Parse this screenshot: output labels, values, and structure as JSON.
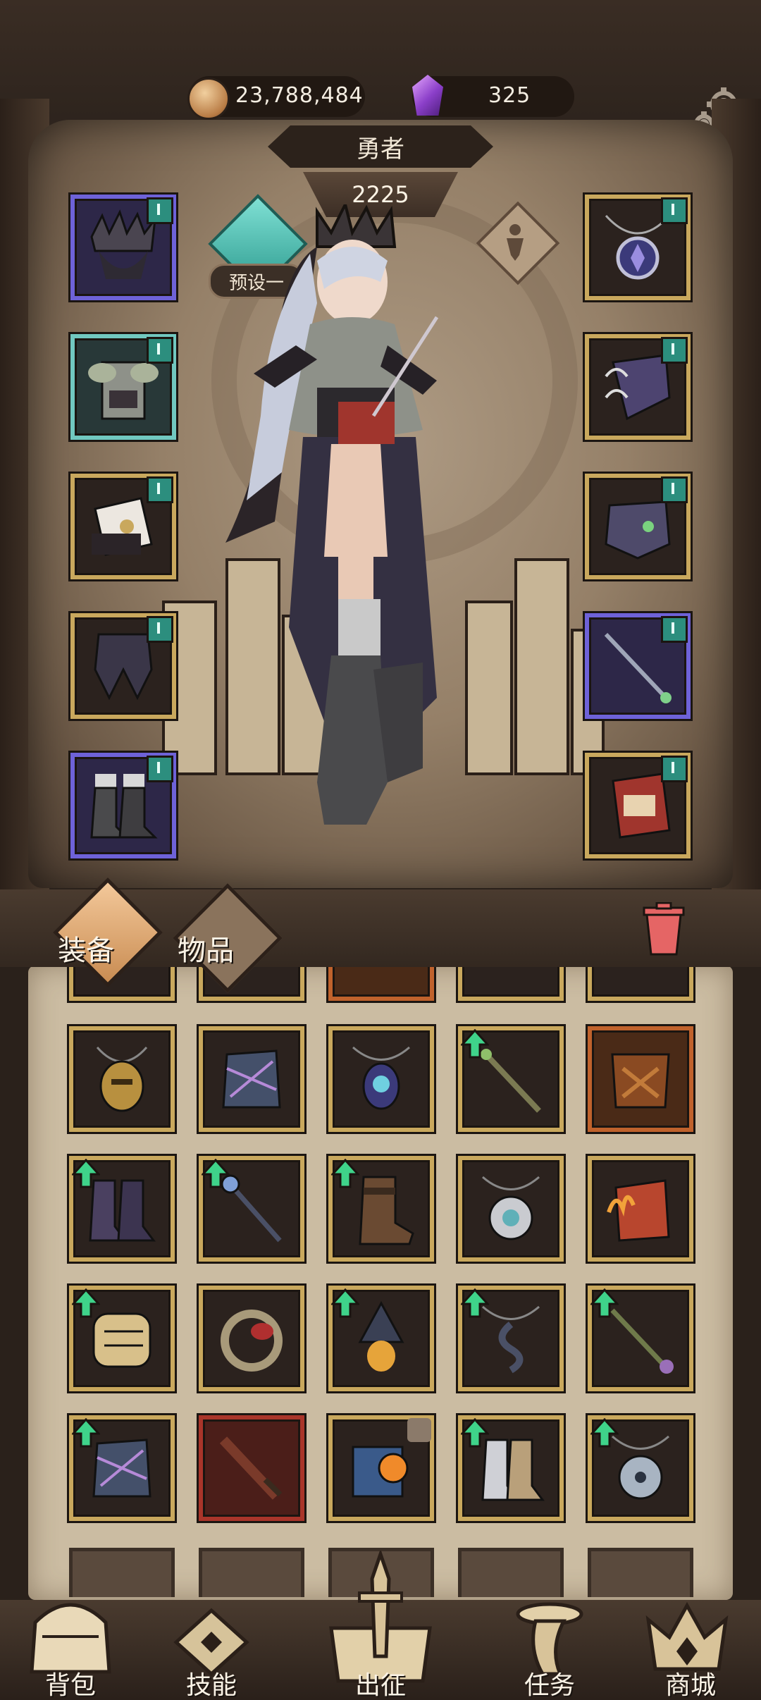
{
  "resources": {
    "gold": "23,788,484",
    "gems": "325"
  },
  "hero": {
    "name": "勇者",
    "power": "2225",
    "preset_label": "预设一"
  },
  "equipment_slots": {
    "left": [
      {
        "icon": "spiked-crown-icon",
        "rarity": "rare"
      },
      {
        "icon": "fur-cape-armor-icon",
        "rarity": "teal"
      },
      {
        "icon": "bracer-icon",
        "rarity": "gold"
      },
      {
        "icon": "leggings-icon",
        "rarity": "gold"
      },
      {
        "icon": "boots-icon",
        "rarity": "rare"
      }
    ],
    "right": [
      {
        "icon": "amulet-icon",
        "rarity": "gold"
      },
      {
        "icon": "claw-gauntlet-icon",
        "rarity": "gold"
      },
      {
        "icon": "beast-ring-icon",
        "rarity": "gold"
      },
      {
        "icon": "wand-icon",
        "rarity": "rare"
      },
      {
        "icon": "spellbook-icon",
        "rarity": "gold"
      }
    ]
  },
  "tabs": {
    "equipment": "装备",
    "items": "物品"
  },
  "inventory": {
    "rows": [
      [
        {
          "icon": "golden-mask-amulet-icon",
          "rarity": "gold",
          "upgrade": false
        },
        {
          "icon": "thorn-robe-icon",
          "rarity": "gold",
          "upgrade": false
        },
        {
          "icon": "eye-pendant-icon",
          "rarity": "gold",
          "upgrade": false
        },
        {
          "icon": "branch-staff-icon",
          "rarity": "gold",
          "upgrade": true
        },
        {
          "icon": "rusted-armor-icon",
          "rarity": "orange",
          "upgrade": false
        }
      ],
      [
        {
          "icon": "purple-boots-icon",
          "rarity": "gold",
          "upgrade": true
        },
        {
          "icon": "bone-scepter-icon",
          "rarity": "gold",
          "upgrade": true
        },
        {
          "icon": "leather-boot-icon",
          "rarity": "gold",
          "upgrade": true
        },
        {
          "icon": "disc-amulet-icon",
          "rarity": "gold",
          "upgrade": false
        },
        {
          "icon": "flame-tome-icon",
          "rarity": "gold",
          "upgrade": false
        }
      ],
      [
        {
          "icon": "fist-gauntlet-icon",
          "rarity": "gold",
          "upgrade": true
        },
        {
          "icon": "serpent-ring-icon",
          "rarity": "gold",
          "upgrade": false
        },
        {
          "icon": "hood-egg-relic-icon",
          "rarity": "gold",
          "upgrade": true
        },
        {
          "icon": "serpent-pendant-icon",
          "rarity": "gold",
          "upgrade": true
        },
        {
          "icon": "twisted-staff-icon",
          "rarity": "gold",
          "upgrade": true
        }
      ],
      [
        {
          "icon": "thorn-robe-icon",
          "rarity": "gold",
          "upgrade": true
        },
        {
          "icon": "rusty-sword-icon",
          "rarity": "red",
          "upgrade": false
        },
        {
          "icon": "orb-tome-icon",
          "rarity": "gold",
          "upgrade": false,
          "locked": true
        },
        {
          "icon": "armored-boots-icon",
          "rarity": "gold",
          "upgrade": true
        },
        {
          "icon": "round-amulet-icon",
          "rarity": "gold",
          "upgrade": true
        }
      ]
    ]
  },
  "nav": {
    "bag": "背包",
    "skills": "技能",
    "expedition": "出征",
    "quests": "任务",
    "shop": "商城"
  },
  "colors": {
    "gold_frame": "#c9a85d",
    "rare_frame": "#6e62d8",
    "upgrade_arrow": "#3fd38a",
    "teal_tag": "#2c8e7e"
  }
}
